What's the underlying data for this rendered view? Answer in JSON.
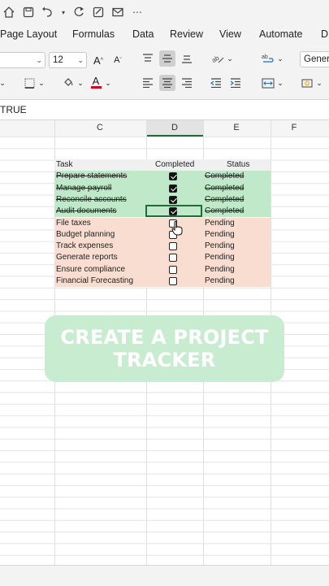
{
  "tabs": [
    "Page Layout",
    "Formulas",
    "Data",
    "Review",
    "View",
    "Automate",
    "D"
  ],
  "ribbon": {
    "font_size": "12",
    "number_format": "Gener"
  },
  "formula_bar": {
    "value": "TRUE"
  },
  "columns": [
    "C",
    "D",
    "E",
    "F"
  ],
  "table": {
    "headers": {
      "task": "Task",
      "completed": "Completed",
      "status": "Status"
    },
    "rows": [
      {
        "task": "Prepare statements",
        "checked": true,
        "status": "Completed"
      },
      {
        "task": "Manage payroll",
        "checked": true,
        "status": "Completed"
      },
      {
        "task": "Reconcile accounts",
        "checked": true,
        "status": "Completed"
      },
      {
        "task": "Audit documents",
        "checked": true,
        "status": "Completed"
      },
      {
        "task": "File taxes",
        "checked": false,
        "status": "Pending"
      },
      {
        "task": "Budget planning",
        "checked": false,
        "status": "Pending"
      },
      {
        "task": "Track expenses",
        "checked": false,
        "status": "Pending"
      },
      {
        "task": "Generate reports",
        "checked": false,
        "status": "Pending"
      },
      {
        "task": "Ensure compliance",
        "checked": false,
        "status": "Pending"
      },
      {
        "task": "Financial Forecasting",
        "checked": false,
        "status": "Pending"
      }
    ]
  },
  "banner": {
    "line1": "CREATE A PROJECT",
    "line2": "TRACKER"
  },
  "colors": {
    "completed_bg": "#bfe9c8",
    "pending_bg": "#f8ddd0",
    "banner_bg": "#c8ecd0",
    "selection": "#1f6b3a"
  }
}
